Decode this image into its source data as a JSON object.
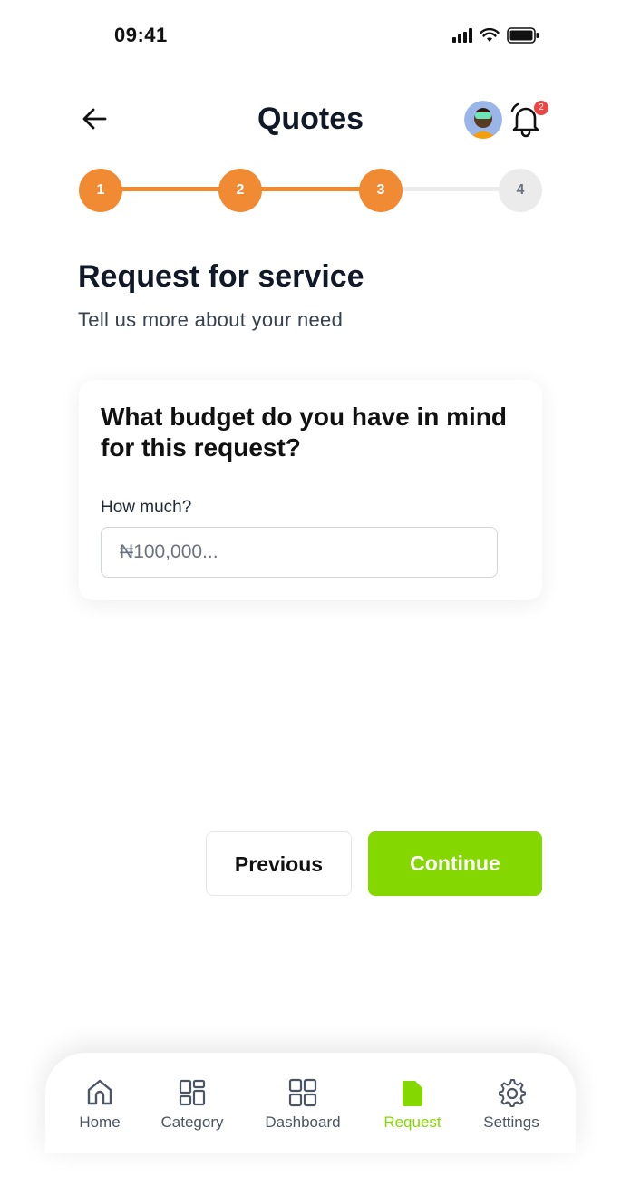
{
  "status_bar": {
    "time": "09:41"
  },
  "header": {
    "title": "Quotes",
    "notification_count": "2"
  },
  "stepper": {
    "steps": [
      "1",
      "2",
      "3",
      "4"
    ],
    "current": 3
  },
  "page": {
    "heading": "Request for service",
    "subheading": "Tell us more about your need"
  },
  "card": {
    "question": "What budget do you have in mind for this request?",
    "label": "How much?",
    "placeholder": "₦100,000..."
  },
  "actions": {
    "previous": "Previous",
    "continue": "Continue"
  },
  "nav": {
    "items": [
      {
        "label": "Home",
        "icon": "home-icon"
      },
      {
        "label": "Category",
        "icon": "category-icon"
      },
      {
        "label": "Dashboard",
        "icon": "dashboard-icon"
      },
      {
        "label": "Request",
        "icon": "request-icon"
      },
      {
        "label": "Settings",
        "icon": "gear-icon"
      }
    ],
    "active": "Request"
  },
  "colors": {
    "accent_orange": "#f08a33",
    "accent_green": "#84d800",
    "badge_red": "#ef4444"
  }
}
